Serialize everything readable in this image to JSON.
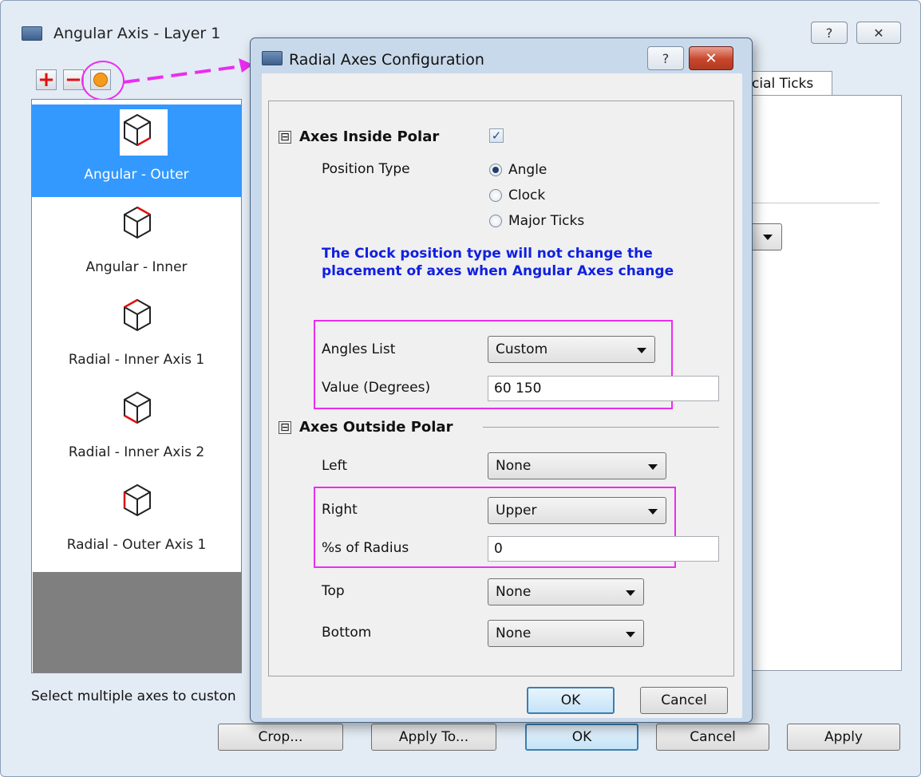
{
  "back_window": {
    "title": "Angular Axis - Layer 1",
    "help_glyph": "?",
    "close_glyph": "✕",
    "toolbar": {
      "add_glyph": "+",
      "remove_glyph": "−"
    },
    "axis_items": [
      {
        "label": "Angular - Outer",
        "selected": true
      },
      {
        "label": "Angular - Inner",
        "selected": false
      },
      {
        "label": "Radial - Inner Axis 1",
        "selected": false
      },
      {
        "label": "Radial - Inner Axis 2",
        "selected": false
      },
      {
        "label": "Radial - Outer Axis 1",
        "selected": false
      }
    ],
    "tab_label": "cial Ticks",
    "status_text": "Select multiple axes to custon",
    "buttons": {
      "crop": "Crop...",
      "apply_to": "Apply To...",
      "ok": "OK",
      "cancel": "Cancel",
      "apply": "Apply"
    }
  },
  "dialog": {
    "title": "Radial Axes Configuration",
    "help_glyph": "?",
    "close_glyph": "✕",
    "inside": {
      "header": "Axes Inside Polar",
      "toggle_glyph": "⊟",
      "checked": true,
      "check_glyph": "✓",
      "position_type_label": "Position Type",
      "options": [
        {
          "label": "Angle",
          "selected": true
        },
        {
          "label": "Clock",
          "selected": false
        },
        {
          "label": "Major Ticks",
          "selected": false
        }
      ],
      "note": "The Clock position type will not change the placement of axes when Angular Axes change",
      "angles_list_label": "Angles List",
      "angles_list_value": "Custom",
      "value_label": "Value (Degrees)",
      "value": "60 150"
    },
    "outside": {
      "header": "Axes Outside Polar",
      "toggle_glyph": "⊟",
      "left_label": "Left",
      "left_value": "None",
      "right_label": "Right",
      "right_value": "Upper",
      "radius_label": "%s of Radius",
      "radius_value": "0",
      "top_label": "Top",
      "top_value": "None",
      "bottom_label": "Bottom",
      "bottom_value": "None"
    },
    "ok": "OK",
    "cancel": "Cancel"
  },
  "colors": {
    "highlight": "#ea2df0",
    "selection": "#3399ff",
    "note": "#1020e0"
  }
}
